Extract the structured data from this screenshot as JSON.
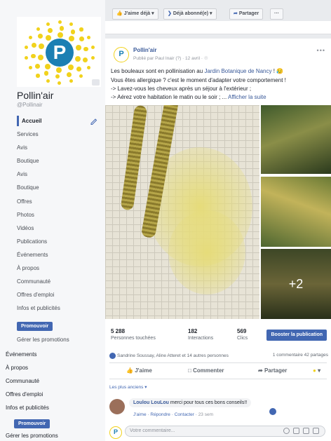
{
  "sidebar": {
    "page_name": "Pollin'air",
    "page_handle": "@Pollinair",
    "logo_letter": "P",
    "nav_items": [
      "Accueil",
      "Services",
      "Avis",
      "Boutique",
      "Avis",
      "Boutique",
      "Offres",
      "Photos",
      "Vidéos",
      "Publications",
      "Événements",
      "À propos",
      "Communauté",
      "Offres d'emploi",
      "Infos et publicités"
    ],
    "promote_label": "Promouvoir",
    "manage_promotions": "Gérer les promotions",
    "nav_items_2": [
      "Événements",
      "À propos",
      "Communauté",
      "Offres d'emploi",
      "Infos et publicités"
    ],
    "promote_label_2": "Promouvoir",
    "manage_promotions_2": "Gérer les promotions"
  },
  "topbar": {
    "like_label": "J'aime déjà",
    "follow_label": "Déjà abonné(e)",
    "share_label": "Partager",
    "more_label": "···"
  },
  "post": {
    "author": "Pollin'air",
    "meta": "Publié par Paul Inair (?) · 12 avril ·",
    "line1_a": "Les bouleaux sont en pollinisation au ",
    "line1_link": "Jardin Botanique de Nancy",
    "line1_b": " ! ",
    "line2": "Vous êtes allergique ? c'est le moment d'adapter votre comportement !",
    "line3": "-> Lavez-vous les cheveux après un séjour à l'extérieur ;",
    "line4_a": "-> Aérez votre habitation le matin ou le soir ; ... ",
    "line4_link": "Afficher la suite",
    "more_photos": "+2",
    "stats": [
      {
        "value": "5 288",
        "label": "Personnes touchées"
      },
      {
        "value": "182",
        "label": "Interactions"
      },
      {
        "value": "569",
        "label": "Clics"
      }
    ],
    "boost_label": "Booster la publication",
    "reactions_text": "Sandrine Soussay, Aline Atteret et 14 autres personnes",
    "comments_shares": "1 commentaire  42 partages",
    "actions": {
      "like": "J'aime",
      "comment": "Commenter",
      "share": "Partager"
    },
    "sort_label": "Les plus anciens ▾",
    "comment": {
      "author": "Loulou LouLou",
      "text": " merci pour tous ces bons conseils!!",
      "like": "J'aime",
      "reply": "Répondre",
      "contact": "Contacter",
      "time": "23 sem"
    },
    "reply_placeholder": "Votre commentaire..."
  },
  "colors": {
    "brand_blue": "#4267b2",
    "logo_yellow": "#f1d21c",
    "logo_blue": "#1b7fb3"
  },
  "icons": [
    "thumbs-up-icon",
    "rss-icon",
    "share-arrow-icon",
    "pencil-icon",
    "globe-icon",
    "camera-icon",
    "emoji-icon"
  ]
}
